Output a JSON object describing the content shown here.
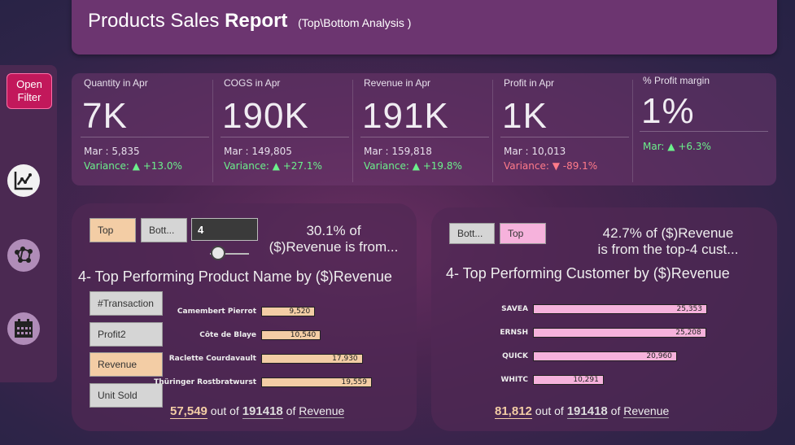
{
  "header": {
    "title_pre": "Products Sales ",
    "title_bold": "Report",
    "subtitle": "(Top\\Bottom Analysis )"
  },
  "sidebar": {
    "open_filter": "Open Filter"
  },
  "kpis": [
    {
      "label": "Quantity in Apr",
      "value": "7K",
      "prev": "Mar : 5,835",
      "variance": "Variance: ▲ +13.0%",
      "trend": "up"
    },
    {
      "label": "COGS in Apr",
      "value": "190K",
      "prev": "Mar : 149,805",
      "variance": "Variance: ▲ +27.1%",
      "trend": "up"
    },
    {
      "label": "Revenue in Apr",
      "value": "191K",
      "prev": "Mar : 159,818",
      "variance": "Variance: ▲ +19.8%",
      "trend": "up"
    },
    {
      "label": "Profit in Apr",
      "value": "1K",
      "prev": "Mar : 10,013",
      "variance": "Variance: ▼ -89.1%",
      "trend": "down"
    },
    {
      "label": "% Profit margin",
      "value": "1%",
      "variance": "Mar: ▲ +6.3%",
      "trend": "up"
    }
  ],
  "products": {
    "top_btn": "Top",
    "bottom_btn": "Bott...",
    "n_value": "4",
    "slider_fraction": 0.2,
    "pct_line1": "30.1% of",
    "pct_line2": "($)Revenue is from...",
    "title": "4- Top Performing Product Name by ($)Revenue",
    "metrics": [
      "#Transaction",
      "Profit2",
      "Revenue",
      "Unit Sold"
    ],
    "active_metric": 2,
    "footer_value": "57,549",
    "footer_mid": "out of",
    "footer_total": "191418",
    "footer_of": "of",
    "footer_unit": "Revenue"
  },
  "customers": {
    "bottom_btn": "Bott...",
    "top_btn": "Top",
    "pct_line1": "42.7% of ($)Revenue",
    "pct_line2": "is from the top-4 cust...",
    "title": "4- Top Performing Customer by ($)Revenue",
    "footer_value": "81,812",
    "footer_mid": "out of",
    "footer_total": "191418",
    "footer_of": "of",
    "footer_unit": "Revenue"
  },
  "chart_data": [
    {
      "type": "bar",
      "orientation": "horizontal",
      "categories": [
        "Camembert Pierrot",
        "Côte de Blaye",
        "Raclette Courdavault",
        "Thüringer Rostbratwurst"
      ],
      "values": [
        9520,
        10540,
        17930,
        19559
      ],
      "value_labels": [
        "9,520",
        "10,540",
        "17,930",
        "19,559"
      ],
      "color": "#f3cda5"
    },
    {
      "type": "bar",
      "orientation": "horizontal",
      "categories": [
        "SAVEA",
        "ERNSH",
        "QUICK",
        "WHITC"
      ],
      "values": [
        25353,
        25208,
        20960,
        10291
      ],
      "value_labels": [
        "25,353",
        "25,208",
        "20,960",
        "10,291"
      ],
      "color": "#f6b2dc"
    }
  ]
}
